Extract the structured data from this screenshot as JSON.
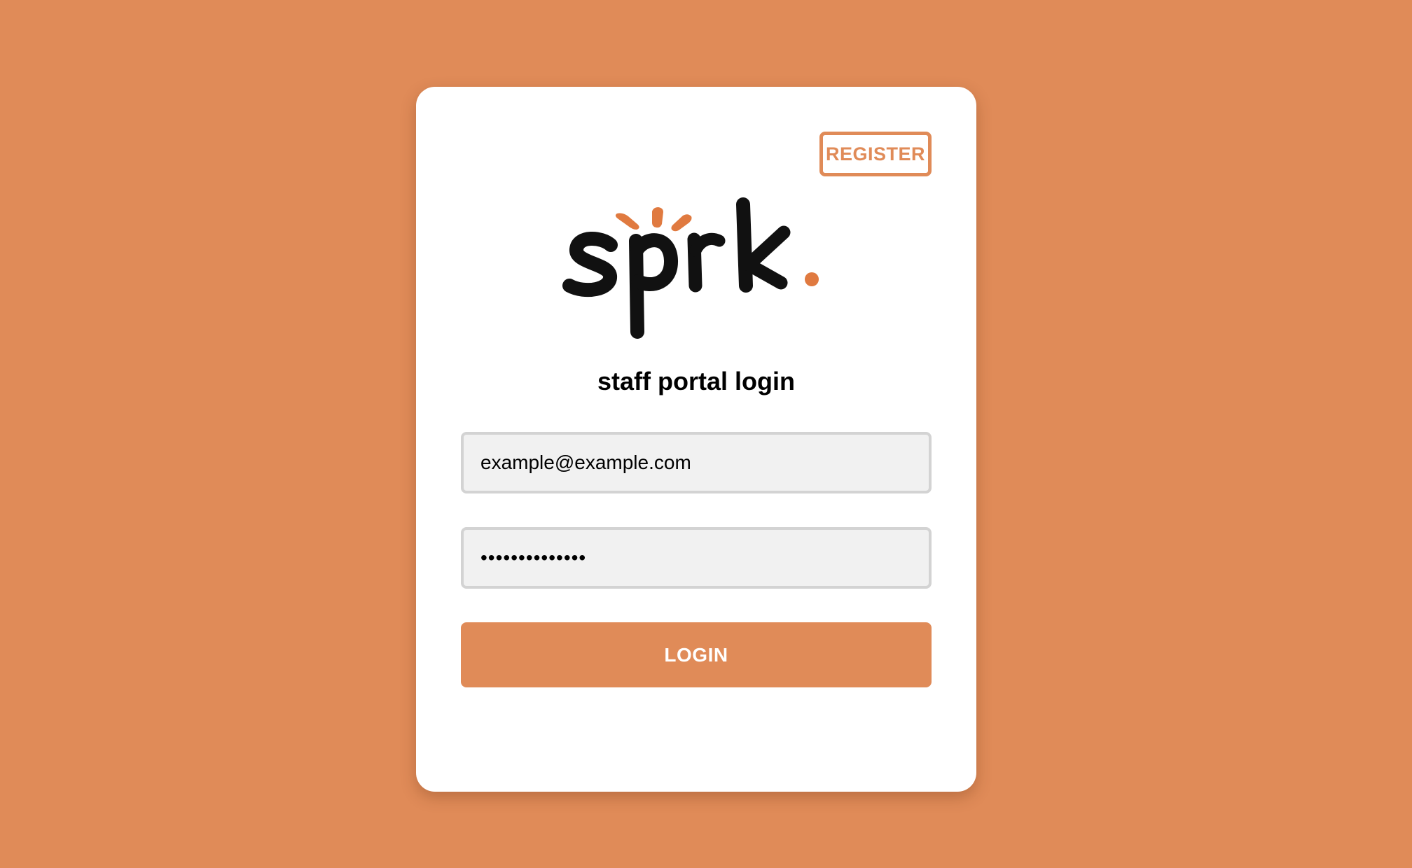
{
  "page": {
    "background_color": "#e08b58",
    "card_color": "#ffffff"
  },
  "header": {
    "register_label": "REGISTER"
  },
  "logo": {
    "text": "sprk.",
    "letter_color": "#111111",
    "accent_color": "#e07a40"
  },
  "login_form": {
    "title": "staff portal login",
    "email": {
      "value": "example@example.com",
      "type": "email"
    },
    "password": {
      "value": "examplepass123",
      "type": "password"
    },
    "submit_label": "LOGIN"
  }
}
